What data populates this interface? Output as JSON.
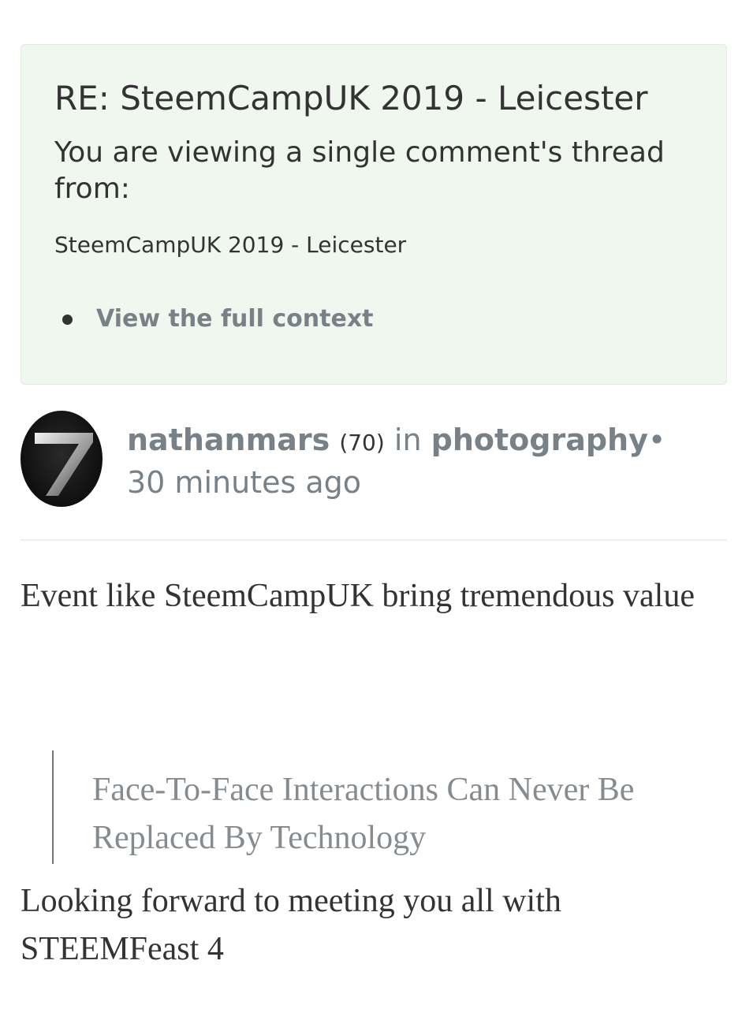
{
  "context": {
    "title": "RE: SteemCampUK 2019 - Leicester",
    "subtitle": "You are viewing a single comment's thread from:",
    "parent_title": "SteemCampUK 2019 - Leicester",
    "links": [
      {
        "label": "View the full context"
      }
    ]
  },
  "author": {
    "avatar_glyph": "7",
    "name": "nathanmars",
    "reputation": "(70)",
    "in_label": "in",
    "category": "photography",
    "separator": "•",
    "time": "30 minutes ago"
  },
  "comment": {
    "paragraph1": "Event like SteemCampUK bring tremendous value",
    "blockquote": "Face-To-Face Interactions Can Never Be Replaced By Technology",
    "paragraph2": "Looking forward to meeting you all with STEEMFeast 4"
  },
  "colors": {
    "context_bg": "#f0f7ee",
    "muted": "#788187",
    "text": "#333333"
  }
}
